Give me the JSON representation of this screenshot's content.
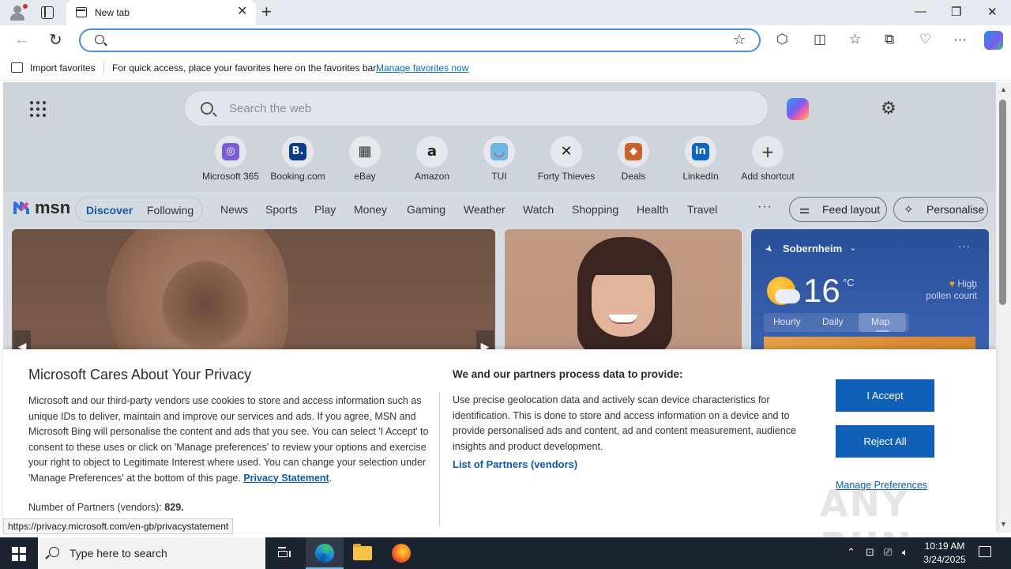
{
  "browser": {
    "tab_title": "New tab",
    "omnibox_value": "",
    "favbar": {
      "import_label": "Import favorites",
      "message": "For quick access, place your favorites here on the favorites bar.",
      "manage_link": "Manage favorites now"
    },
    "status_url": "https://privacy.microsoft.com/en-gb/privacystatement"
  },
  "newtab": {
    "search_placeholder": "Search the web",
    "shortcuts": [
      {
        "label": "Microsoft 365",
        "icon": "microsoft-365-icon",
        "color": "#7b5cd6",
        "glyph": "◎"
      },
      {
        "label": "Booking.com",
        "icon": "booking-icon",
        "color": "#0d3b8c",
        "glyph": "B."
      },
      {
        "label": "eBay",
        "icon": "ebay-icon",
        "color": "#333333",
        "glyph": "▦"
      },
      {
        "label": "Amazon",
        "icon": "amazon-icon",
        "color": "#222222",
        "glyph": "a"
      },
      {
        "label": "TUI",
        "icon": "tui-icon",
        "color": "#6fb6e8",
        "glyph": "◡"
      },
      {
        "label": "Forty Thieves",
        "icon": "forty-thieves-icon",
        "color": "#1a1a1a",
        "glyph": "✕"
      },
      {
        "label": "Deals",
        "icon": "deals-icon",
        "color": "#c8612a",
        "glyph": "◆"
      },
      {
        "label": "LinkedIn",
        "icon": "linkedin-icon",
        "color": "#0a66c2",
        "glyph": "in"
      },
      {
        "label": "Add shortcut",
        "icon": "add-icon",
        "color": "#e4e7ec",
        "glyph": "+"
      }
    ],
    "msn": {
      "logo_text": "msn",
      "pills": [
        "Discover",
        "Following"
      ],
      "nav": [
        "News",
        "Sports",
        "Play",
        "Money",
        "Gaming",
        "Weather",
        "Watch",
        "Shopping",
        "Health",
        "Travel"
      ],
      "more": "···",
      "feed_layout": "Feed layout",
      "personalise": "Personalise"
    },
    "weather": {
      "location": "Sobernheim",
      "temperature": "16",
      "unit": "°C",
      "pollen_line1": "High",
      "pollen_line2": "pollen count",
      "tabs": [
        "Hourly",
        "Daily",
        "Map"
      ],
      "selected_tab": "Map",
      "more": "···"
    }
  },
  "privacy": {
    "title": "Microsoft Cares About Your Privacy",
    "body": "Microsoft and our third-party vendors use cookies to store and access information such as unique IDs to deliver, maintain and improve our services and ads. If you agree, MSN and Microsoft Bing will personalise the content and ads that you see. You can select 'I Accept' to consent to these uses or click on 'Manage preferences' to review your options and exercise your right to object to Legitimate Interest where used.  You can change your selection under 'Manage Preferences' at the bottom of this page.",
    "privacy_link": "Privacy Statement",
    "partners_label": "Number of Partners (vendors):",
    "partners_count": "829.",
    "purposes_heading": "We and our partners process data to provide:",
    "purposes_body": "Use precise geolocation data and actively scan device characteristics for identification. This is done to store and access information on a device and to provide personalised ads and content, ad and content measurement, audience insights and product development.",
    "partners_list_link": "List of Partners (vendors)",
    "accept": "I Accept",
    "reject": "Reject All",
    "manage": "Manage Preferences"
  },
  "taskbar": {
    "search_placeholder": "Type here to search",
    "time": "10:19 AM",
    "date": "3/24/2025"
  },
  "watermark": "ANY RUN"
}
